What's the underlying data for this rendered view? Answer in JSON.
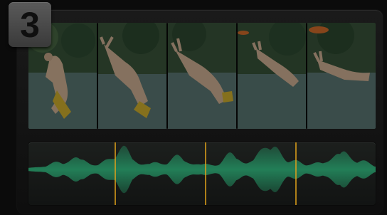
{
  "badge": {
    "step_number": "3"
  },
  "filmstrip": {
    "frames": [
      {
        "name": "frame-1"
      },
      {
        "name": "frame-2"
      },
      {
        "name": "frame-3"
      },
      {
        "name": "frame-4"
      },
      {
        "name": "frame-5"
      },
      {
        "name": "frame-6"
      }
    ]
  },
  "audio": {
    "waveform_color": "#2bd08a",
    "marker_color": "#e1a21a",
    "cut_markers": [
      "marker-1",
      "marker-2",
      "marker-3"
    ]
  },
  "colors": {
    "background": "#0b0b0b",
    "panel": "#161616",
    "badge": "#4a4a4a"
  }
}
